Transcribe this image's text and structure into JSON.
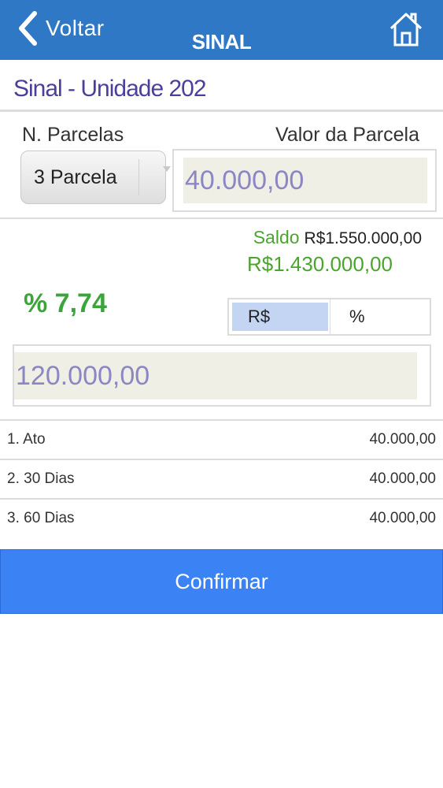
{
  "navbar": {
    "back_label": "Voltar",
    "title": "SINAL",
    "icons": {
      "back": "chevron-left-icon",
      "home": "home-icon"
    }
  },
  "section": {
    "title": "Sinal - Unidade 202"
  },
  "parcelas": {
    "label": "N. Parcelas",
    "selected": "3 Parcela"
  },
  "valor_parcela": {
    "label": "Valor da Parcela",
    "value": "40.000,00"
  },
  "saldo": {
    "label": "Saldo",
    "total": "R$1.550.000,00",
    "remaining": "R$1.430.000,00"
  },
  "percent": {
    "value": "% 7,74"
  },
  "mode_toggle": {
    "options": [
      "R$",
      "%"
    ],
    "selected": "R$"
  },
  "sinal_total": {
    "value": "120.000,00"
  },
  "installments": [
    {
      "label": "1. Ato",
      "value": "40.000,00"
    },
    {
      "label": "2. 30 Dias",
      "value": "40.000,00"
    },
    {
      "label": "3. 60 Dias",
      "value": "40.000,00"
    }
  ],
  "confirm": {
    "label": "Confirmar"
  },
  "colors": {
    "navbar": "#2e78c5",
    "title": "#4a3f9a",
    "green": "#4aa52e",
    "input_text": "#8b86c4",
    "button": "#3b82f4"
  }
}
